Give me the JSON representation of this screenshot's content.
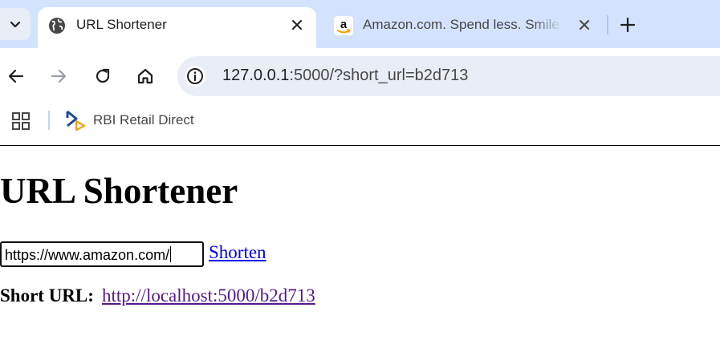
{
  "browser": {
    "tabs": [
      {
        "title": "URL Shortener",
        "favicon": "globe-icon",
        "active": true
      },
      {
        "title": "Amazon.com. Spend less. Smile more.",
        "favicon": "amazon-logo-icon",
        "active": false
      }
    ],
    "address": {
      "host": "127.0.0.1",
      "rest": ":5000/?short_url=b2d713"
    },
    "bookmarks": [
      {
        "label": "RBI Retail Direct",
        "icon": "rbi-logo-icon"
      }
    ],
    "colors": {
      "tabstrip": "#d3e3fd",
      "omnibox": "#e9eef6"
    }
  },
  "page": {
    "heading": "URL Shortener",
    "url_input_value": "https://www.amazon.com/",
    "shorten_link": "Shorten",
    "short_url_label": "Short URL:",
    "short_url_link": "http://localhost:5000/b2d713",
    "colors": {
      "link": "#0000ee",
      "visited_link": "#551a8b"
    }
  }
}
